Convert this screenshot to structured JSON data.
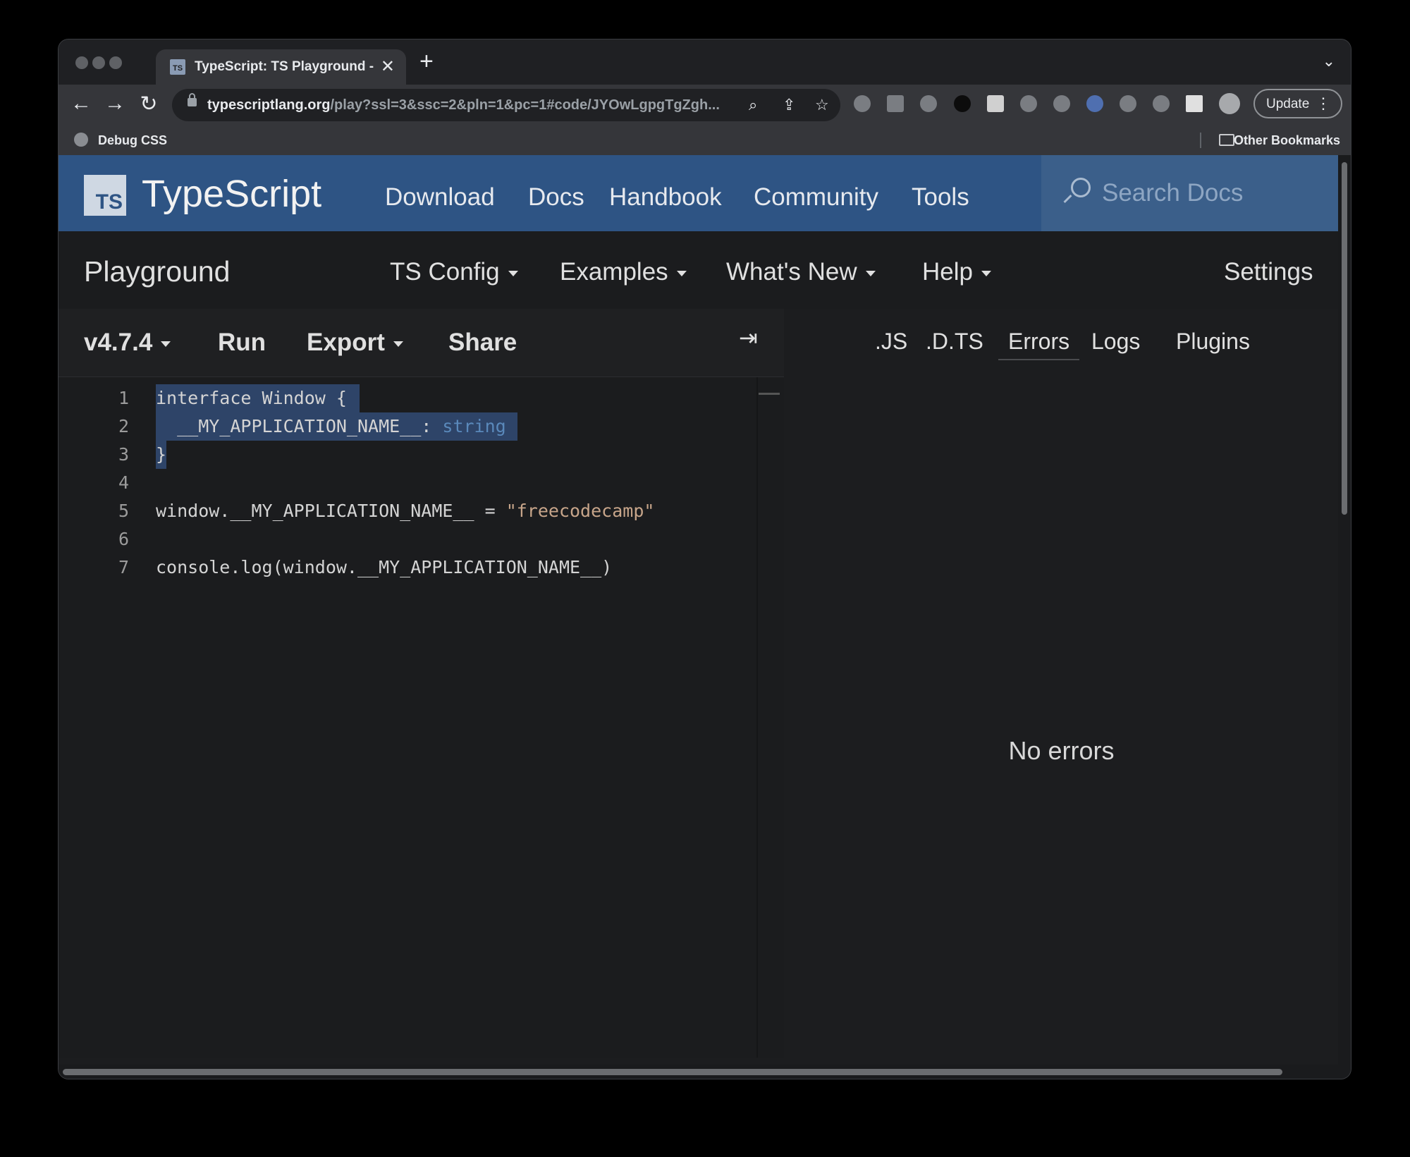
{
  "browser": {
    "tab_title": "TypeScript: TS Playground - An online editor for exploring TypeScript",
    "tab_favicon": "TS",
    "tab_close": "✕",
    "new_tab": "+",
    "tab_menu": "⌄",
    "url_host": "typescriptlang.org",
    "url_path": "/play?ssl=3&ssc=2&pln=1&pc=1#code/JYOwLgpgTgZgh...",
    "update_label": "Update",
    "bookmark_debug": "Debug CSS",
    "bookmark_other": "Other Bookmarks"
  },
  "header": {
    "logo_text": "TS",
    "brand": "TypeScript",
    "nav": [
      "Download",
      "Docs",
      "Handbook",
      "Community",
      "Tools"
    ],
    "search_placeholder": "Search Docs"
  },
  "subnav": {
    "title": "Playground",
    "menus": [
      "TS Config",
      "Examples",
      "What's New",
      "Help"
    ],
    "settings": "Settings"
  },
  "editor_toolbar": {
    "version": "v4.7.4",
    "run": "Run",
    "export": "Export",
    "share": "Share",
    "collapse_icon": "⇥"
  },
  "editor": {
    "line_numbers": [
      "1",
      "2",
      "3",
      "4",
      "5",
      "6",
      "7"
    ],
    "lines": {
      "l1_kw": "interface Window {",
      "l2_indent": "  ",
      "l2_prop": "__MY_APPLICATION_NAME__: ",
      "l2_type": "string",
      "l3": "}",
      "l5_pre": "window.__MY_APPLICATION_NAME__ = ",
      "l5_str": "\"freecodecamp\"",
      "l7": "console.log(window.__MY_APPLICATION_NAME__)"
    }
  },
  "output": {
    "tabs": [
      ".JS",
      ".D.TS",
      "Errors",
      "Logs",
      "Plugins"
    ],
    "active_tab": "Errors",
    "message": "No errors"
  },
  "colors": {
    "header_bg": "#2e5484",
    "selection": "#2e4468",
    "keyword": "#5a89bb",
    "string": "#c7a58a"
  }
}
